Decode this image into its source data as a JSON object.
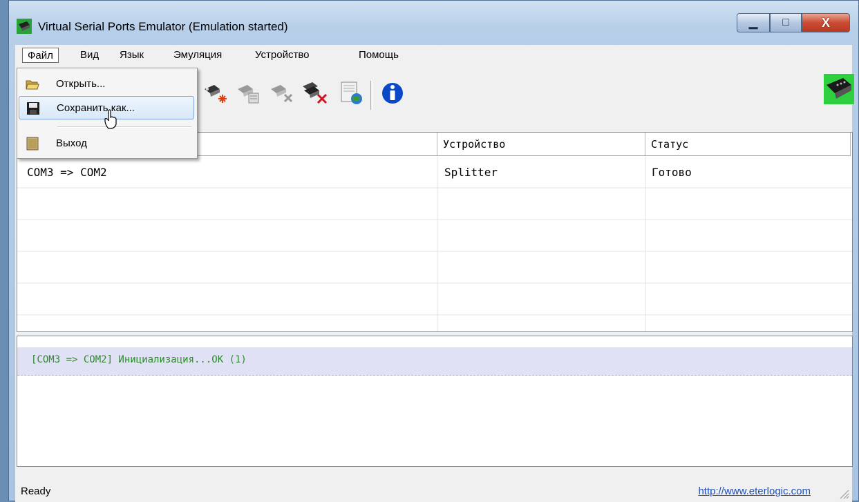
{
  "window": {
    "title": "Virtual Serial Ports Emulator (Emulation started)",
    "minimize_glyph": "▁",
    "maximize_glyph": "□",
    "close_glyph": "X"
  },
  "menubar": {
    "items": [
      {
        "label": "Файл"
      },
      {
        "label": "Вид"
      },
      {
        "label": "Язык"
      },
      {
        "label": "Эмуляция"
      },
      {
        "label": "Устройство"
      },
      {
        "label": "Помощь"
      }
    ]
  },
  "file_menu": {
    "items": [
      {
        "label": "Открыть...",
        "icon": "open-folder-icon"
      },
      {
        "label": "Сохранить как...",
        "icon": "floppy-disk-icon",
        "highlighted": true
      },
      {
        "label": "Выход",
        "icon": "exit-door-icon"
      }
    ]
  },
  "toolbar": {
    "icons": [
      "new-device-icon",
      "device-properties-icon",
      "remove-device-icon",
      "remove-all-devices-icon",
      "log-settings-icon",
      "info-icon",
      "serial-connector-logo-icon"
    ]
  },
  "grid": {
    "columns": [
      "",
      "Устройство",
      "Статус"
    ],
    "rows": [
      {
        "name": "COM3 => COM2",
        "device": "Splitter",
        "status": "Готово"
      }
    ]
  },
  "log": {
    "lines": [
      "[COM3 => COM2] Инициализация...OK (1)"
    ]
  },
  "statusbar": {
    "text": "Ready",
    "link": "http://www.eterlogic.com"
  },
  "colors": {
    "log_text": "#2d8a2d",
    "log_highlight": "#e1e1f5",
    "menu_highlight": "#d9e8f9",
    "link": "#1e4fb7"
  }
}
